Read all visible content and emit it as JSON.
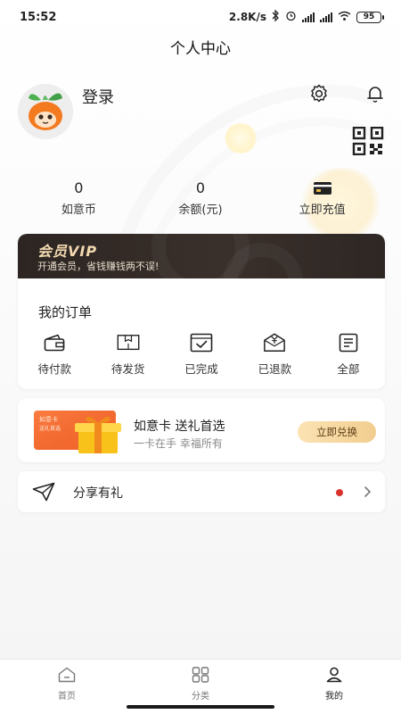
{
  "status_bar": {
    "time": "15:52",
    "network_speed": "2.8K/s",
    "battery": "95"
  },
  "page_title": "个人中心",
  "profile": {
    "login_label": "登录"
  },
  "stats": [
    {
      "value": "0",
      "label": "如意币"
    },
    {
      "value": "0",
      "label": "余额(元)"
    },
    {
      "label": "立即充值",
      "icon": "card-icon"
    }
  ],
  "vip": {
    "title": "会员VIP",
    "subtitle": "开通会员，省钱赚钱两不误!"
  },
  "orders": {
    "title": "我的订单",
    "items": [
      {
        "label": "待付款",
        "icon": "wallet-icon"
      },
      {
        "label": "待发货",
        "icon": "box-icon"
      },
      {
        "label": "已完成",
        "icon": "checked-box-icon"
      },
      {
        "label": "已退款",
        "icon": "refund-icon"
      },
      {
        "label": "全部",
        "icon": "list-icon"
      }
    ]
  },
  "gift_card": {
    "title": "如意卡 送礼首选",
    "subtitle": "一卡在手 幸福所有",
    "button_label": "立即兑换",
    "card_text_1": "如意卡",
    "card_text_2": "送礼首选"
  },
  "share": {
    "label": "分享有礼"
  },
  "bottom_nav": [
    {
      "label": "首页",
      "icon": "home-icon",
      "active": false
    },
    {
      "label": "分类",
      "icon": "grid-icon",
      "active": false
    },
    {
      "label": "我的",
      "icon": "user-icon",
      "active": true
    }
  ],
  "colors": {
    "vip_gold": "#f3d9b0",
    "vip_dark": "#2c2522",
    "exchange_button": "#f1cd8f",
    "red_dot": "#d9322b"
  }
}
